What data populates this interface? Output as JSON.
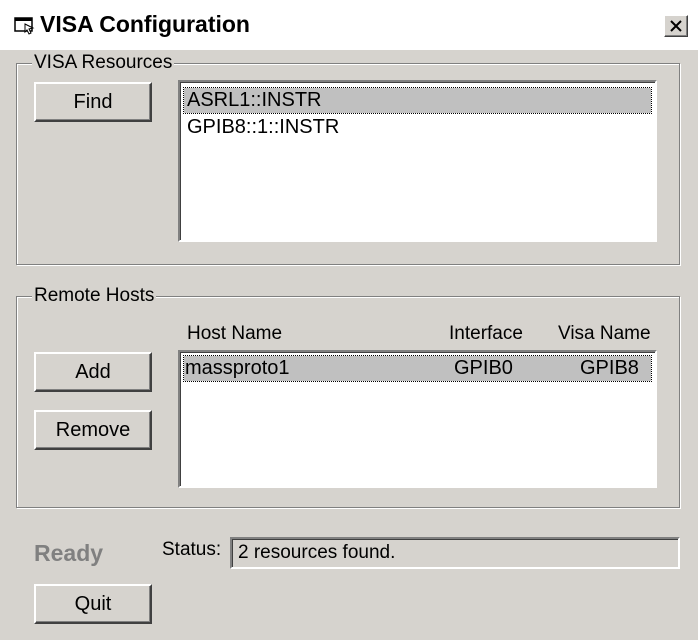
{
  "window": {
    "title": "VISA Configuration",
    "close_label": "X"
  },
  "visa_resources": {
    "group_label": "VISA Resources",
    "find_label": "Find",
    "items": [
      {
        "label": "ASRL1::INSTR",
        "selected": true
      },
      {
        "label": "GPIB8::1::INSTR",
        "selected": false
      }
    ]
  },
  "remote_hosts": {
    "group_label": "Remote Hosts",
    "columns": [
      "Host Name",
      "Interface",
      "Visa Name"
    ],
    "rows": [
      {
        "host_name": "massproto1",
        "interface": "GPIB0",
        "visa_name": "GPIB8",
        "selected": true
      }
    ],
    "add_label": "Add",
    "remove_label": "Remove"
  },
  "status": {
    "ready_text": "Ready",
    "label": "Status:",
    "value": "2 resources found."
  },
  "quit_label": "Quit",
  "colors": {
    "face": "#d6d3ce",
    "selection": "#c0c0c0",
    "ready_text": "#808080"
  }
}
